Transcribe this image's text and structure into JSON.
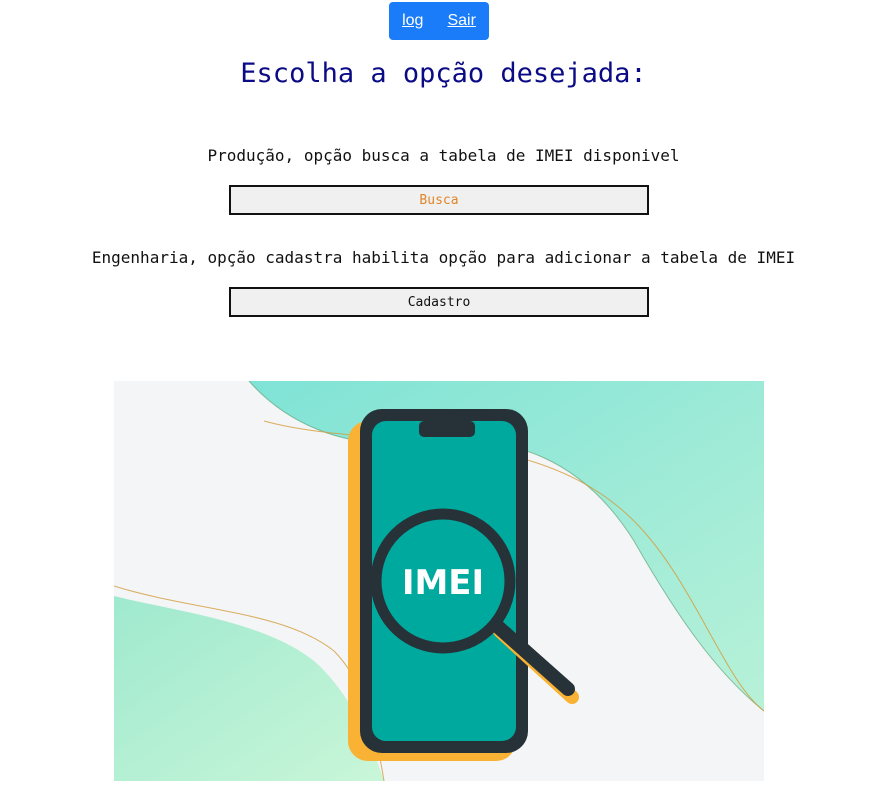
{
  "nav": {
    "log_label": "log",
    "exit_label": "Sair"
  },
  "page": {
    "title": "Escolha a opção desejada:"
  },
  "options": [
    {
      "description": "Produção, opção busca a tabela de IMEI disponivel",
      "button_label": "Busca"
    },
    {
      "description": "Engenharia, opção cadastra habilita opção para adicionar a tabela de IMEI",
      "button_label": "Cadastro"
    }
  ],
  "illustration": {
    "badge_text": "IMEI",
    "icons": [
      "smartphone-icon",
      "magnifier-icon"
    ]
  },
  "colors": {
    "nav_bg": "#1a7cf8",
    "title": "#0b0b85",
    "busca_label": "#e0862a",
    "phone_screen": "#00a99d",
    "phone_frame": "#263238",
    "phone_shadow": "#f9b233",
    "bg_mint": "#a8ecd5"
  }
}
